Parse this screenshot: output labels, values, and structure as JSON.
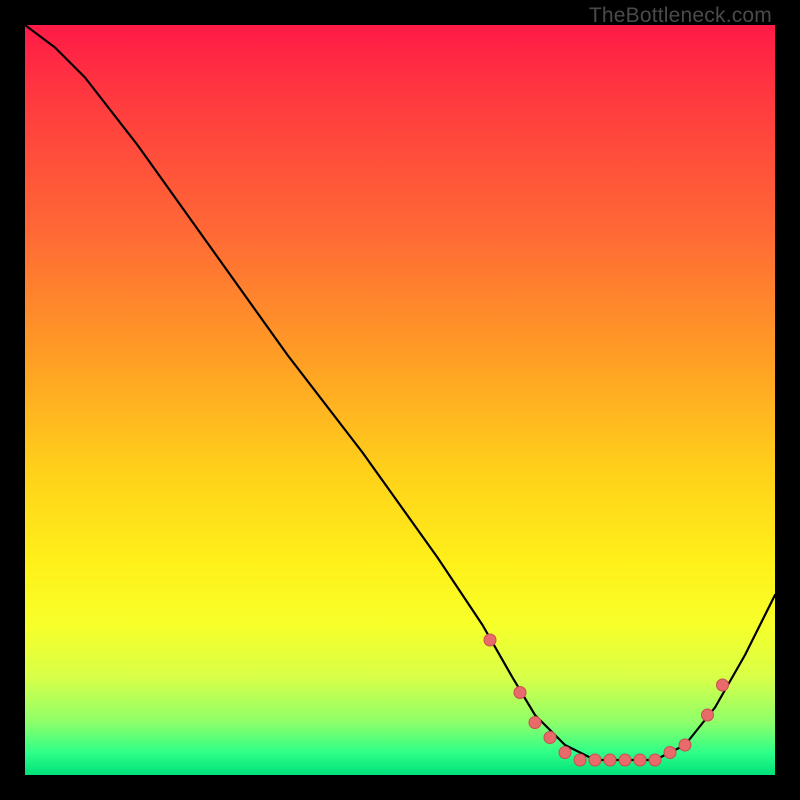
{
  "watermark": "TheBottleneck.com",
  "colors": {
    "curve": "#000000",
    "marker_fill": "#e86a6a",
    "marker_stroke": "#c94f4f"
  },
  "chart_data": {
    "type": "line",
    "title": "",
    "xlabel": "",
    "ylabel": "",
    "xlim": [
      0,
      100
    ],
    "ylim": [
      0,
      100
    ],
    "grid": false,
    "note": "Axes unlabeled; x/y are percentage of plot area (0-100). y=0 is bottom (green), y=100 is top (red). Curve descends from top-left to a flat valley near bottom-right then rises.",
    "x": [
      0,
      4,
      8,
      15,
      25,
      35,
      45,
      55,
      61,
      65,
      68,
      72,
      76,
      80,
      84,
      88,
      92,
      96,
      100
    ],
    "y": [
      100,
      97,
      93,
      84,
      70,
      56,
      43,
      29,
      20,
      13,
      8,
      4,
      2,
      2,
      2,
      4,
      9,
      16,
      24
    ],
    "markers": {
      "note": "Salmon dots clustered in the valley and on the right ascent.",
      "x": [
        62,
        66,
        68,
        70,
        72,
        74,
        76,
        78,
        80,
        82,
        84,
        86,
        88,
        91,
        93
      ],
      "y": [
        18,
        11,
        7,
        5,
        3,
        2,
        2,
        2,
        2,
        2,
        2,
        3,
        4,
        8,
        12
      ]
    }
  }
}
